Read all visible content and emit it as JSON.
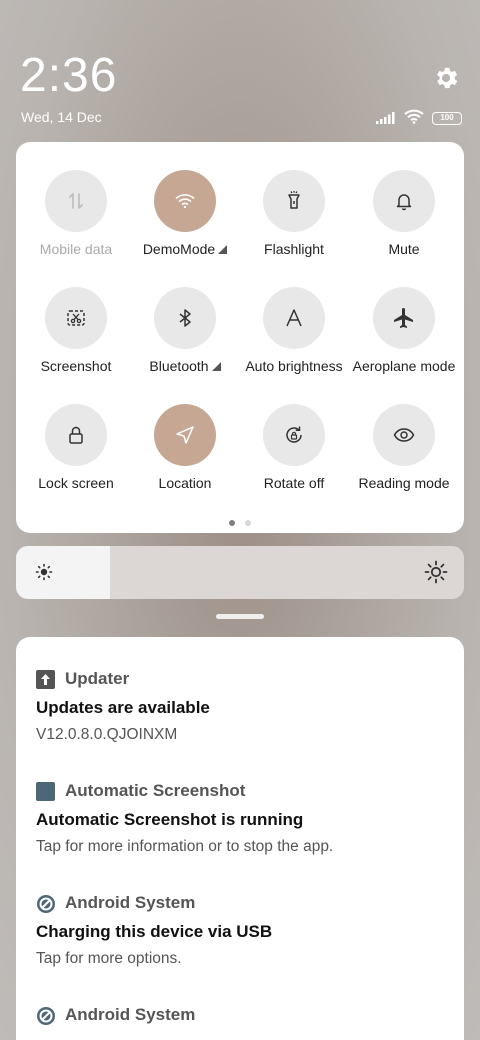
{
  "status": {
    "time": "2:36",
    "date": "Wed, 14 Dec",
    "battery": "100"
  },
  "quick_settings": {
    "tiles": [
      {
        "label": "Mobile data",
        "icon": "mobile-data-icon",
        "active": false,
        "disabled": true,
        "arrow": false
      },
      {
        "label": "DemoMode",
        "icon": "wifi-icon",
        "active": true,
        "disabled": false,
        "arrow": true
      },
      {
        "label": "Flashlight",
        "icon": "flashlight-icon",
        "active": false,
        "disabled": false,
        "arrow": false
      },
      {
        "label": "Mute",
        "icon": "bell-icon",
        "active": false,
        "disabled": false,
        "arrow": false
      },
      {
        "label": "Screenshot",
        "icon": "screenshot-icon",
        "active": false,
        "disabled": false,
        "arrow": false
      },
      {
        "label": "Bluetooth",
        "icon": "bluetooth-icon",
        "active": false,
        "disabled": false,
        "arrow": true
      },
      {
        "label": "Auto brightness",
        "icon": "auto-brightness-icon",
        "active": false,
        "disabled": false,
        "arrow": false
      },
      {
        "label": "Aeroplane mode",
        "icon": "airplane-icon",
        "active": false,
        "disabled": false,
        "arrow": false
      },
      {
        "label": "Lock screen",
        "icon": "lock-icon",
        "active": false,
        "disabled": false,
        "arrow": false
      },
      {
        "label": "Location",
        "icon": "location-icon",
        "active": true,
        "disabled": false,
        "arrow": false
      },
      {
        "label": "Rotate off",
        "icon": "rotate-lock-icon",
        "active": false,
        "disabled": false,
        "arrow": false
      },
      {
        "label": "Reading mode",
        "icon": "eye-icon",
        "active": false,
        "disabled": false,
        "arrow": false
      }
    ],
    "page_count": 2,
    "current_page": 1
  },
  "brightness": {
    "level": 0.21
  },
  "notifications": [
    {
      "app": "Updater",
      "icon": "upload-arrow-icon",
      "title": "Updates are available",
      "body": "V12.0.8.0.QJOINXM"
    },
    {
      "app": "Automatic Screenshot",
      "icon": "app-square-icon",
      "title": "Automatic Screenshot is running",
      "body": "Tap for more information or to stop the app."
    },
    {
      "app": "Android System",
      "icon": "android-system-icon",
      "title": "Charging this device via USB",
      "body": "Tap for more options."
    },
    {
      "app": "Android System",
      "icon": "android-system-icon",
      "title": "",
      "body": ""
    }
  ],
  "colors": {
    "active_tile": "#c5a793",
    "inactive_tile": "#e8e8e8",
    "app_square": "#4c6876"
  }
}
